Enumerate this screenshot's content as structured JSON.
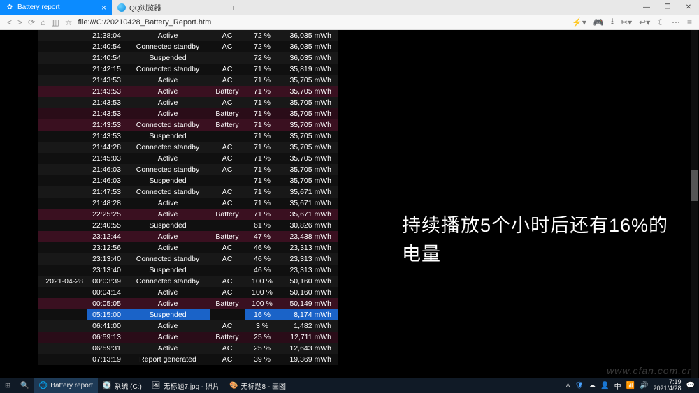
{
  "browser": {
    "tabs": [
      {
        "label": "Battery report",
        "active": true
      },
      {
        "label": "QQ浏览器",
        "active": false
      }
    ],
    "url": "file:///C:/20210428_Battery_Report.html"
  },
  "overlay_text": "持续播放5个小时后还有16%的电量",
  "watermark": "www.cfan.com.cn",
  "rows": [
    {
      "date": "",
      "time": "21:38:04",
      "state": "Active",
      "source": "AC",
      "pct": "72 %",
      "energy": "36,035 mWh",
      "cls": "dark"
    },
    {
      "date": "",
      "time": "21:40:54",
      "state": "Connected standby",
      "source": "AC",
      "pct": "72 %",
      "energy": "36,035 mWh",
      "cls": "darker"
    },
    {
      "date": "",
      "time": "21:40:54",
      "state": "Suspended",
      "source": "",
      "pct": "72 %",
      "energy": "36,035 mWh",
      "cls": "dark"
    },
    {
      "date": "",
      "time": "21:42:15",
      "state": "Connected standby",
      "source": "AC",
      "pct": "71 %",
      "energy": "35,819 mWh",
      "cls": "darker"
    },
    {
      "date": "",
      "time": "21:43:53",
      "state": "Active",
      "source": "AC",
      "pct": "71 %",
      "energy": "35,705 mWh",
      "cls": "dark"
    },
    {
      "date": "",
      "time": "21:43:53",
      "state": "Active",
      "source": "Battery",
      "pct": "71 %",
      "energy": "35,705 mWh",
      "cls": "maroon"
    },
    {
      "date": "",
      "time": "21:43:53",
      "state": "Active",
      "source": "AC",
      "pct": "71 %",
      "energy": "35,705 mWh",
      "cls": "dark"
    },
    {
      "date": "",
      "time": "21:43:53",
      "state": "Active",
      "source": "Battery",
      "pct": "71 %",
      "energy": "35,705 mWh",
      "cls": "maroon2"
    },
    {
      "date": "",
      "time": "21:43:53",
      "state": "Connected standby",
      "source": "Battery",
      "pct": "71 %",
      "energy": "35,705 mWh",
      "cls": "maroon"
    },
    {
      "date": "",
      "time": "21:43:53",
      "state": "Suspended",
      "source": "",
      "pct": "71 %",
      "energy": "35,705 mWh",
      "cls": "darker"
    },
    {
      "date": "",
      "time": "21:44:28",
      "state": "Connected standby",
      "source": "AC",
      "pct": "71 %",
      "energy": "35,705 mWh",
      "cls": "dark"
    },
    {
      "date": "",
      "time": "21:45:03",
      "state": "Active",
      "source": "AC",
      "pct": "71 %",
      "energy": "35,705 mWh",
      "cls": "darker"
    },
    {
      "date": "",
      "time": "21:46:03",
      "state": "Connected standby",
      "source": "AC",
      "pct": "71 %",
      "energy": "35,705 mWh",
      "cls": "dark"
    },
    {
      "date": "",
      "time": "21:46:03",
      "state": "Suspended",
      "source": "",
      "pct": "71 %",
      "energy": "35,705 mWh",
      "cls": "darker"
    },
    {
      "date": "",
      "time": "21:47:53",
      "state": "Connected standby",
      "source": "AC",
      "pct": "71 %",
      "energy": "35,671 mWh",
      "cls": "dark"
    },
    {
      "date": "",
      "time": "21:48:28",
      "state": "Active",
      "source": "AC",
      "pct": "71 %",
      "energy": "35,671 mWh",
      "cls": "darker"
    },
    {
      "date": "",
      "time": "22:25:25",
      "state": "Active",
      "source": "Battery",
      "pct": "71 %",
      "energy": "35,671 mWh",
      "cls": "maroon"
    },
    {
      "date": "",
      "time": "22:40:55",
      "state": "Suspended",
      "source": "",
      "pct": "61 %",
      "energy": "30,826 mWh",
      "cls": "darker"
    },
    {
      "date": "",
      "time": "23:12:44",
      "state": "Active",
      "source": "Battery",
      "pct": "47 %",
      "energy": "23,438 mWh",
      "cls": "maroon"
    },
    {
      "date": "",
      "time": "23:12:56",
      "state": "Active",
      "source": "AC",
      "pct": "46 %",
      "energy": "23,313 mWh",
      "cls": "darker"
    },
    {
      "date": "",
      "time": "23:13:40",
      "state": "Connected standby",
      "source": "AC",
      "pct": "46 %",
      "energy": "23,313 mWh",
      "cls": "dark"
    },
    {
      "date": "",
      "time": "23:13:40",
      "state": "Suspended",
      "source": "",
      "pct": "46 %",
      "energy": "23,313 mWh",
      "cls": "darker"
    },
    {
      "date": "2021-04-28",
      "time": "00:03:39",
      "state": "Connected standby",
      "source": "AC",
      "pct": "100 %",
      "energy": "50,160 mWh",
      "cls": "dark"
    },
    {
      "date": "",
      "time": "00:04:14",
      "state": "Active",
      "source": "AC",
      "pct": "100 %",
      "energy": "50,160 mWh",
      "cls": "darker"
    },
    {
      "date": "",
      "time": "00:05:05",
      "state": "Active",
      "source": "Battery",
      "pct": "100 %",
      "energy": "50,149 mWh",
      "cls": "maroon"
    },
    {
      "date": "",
      "time": "05:15:00",
      "state": "Suspended",
      "source": "",
      "pct": "16 %",
      "energy": "8,174 mWh",
      "cls": "darker hl"
    },
    {
      "date": "",
      "time": "06:41:00",
      "state": "Active",
      "source": "AC",
      "pct": "3 %",
      "energy": "1,482 mWh",
      "cls": "dark"
    },
    {
      "date": "",
      "time": "06:59:13",
      "state": "Active",
      "source": "Battery",
      "pct": "25 %",
      "energy": "12,711 mWh",
      "cls": "maroon2"
    },
    {
      "date": "",
      "time": "06:59:31",
      "state": "Active",
      "source": "AC",
      "pct": "25 %",
      "energy": "12,643 mWh",
      "cls": "dark"
    },
    {
      "date": "",
      "time": "07:13:19",
      "state": "Report generated",
      "source": "AC",
      "pct": "39 %",
      "energy": "19,369 mWh",
      "cls": "darker"
    }
  ],
  "taskbar": {
    "items": [
      {
        "label": "Battery report",
        "icon": "🌐",
        "active": true
      },
      {
        "label": "系统 (C:)",
        "icon": "💽",
        "active": false
      },
      {
        "label": "无标题7.jpg - 照片",
        "icon": "🖼",
        "active": false
      },
      {
        "label": "无标题8 - 画图",
        "icon": "🎨",
        "active": false
      }
    ],
    "time": "7:19",
    "date": "2021/4/28"
  }
}
